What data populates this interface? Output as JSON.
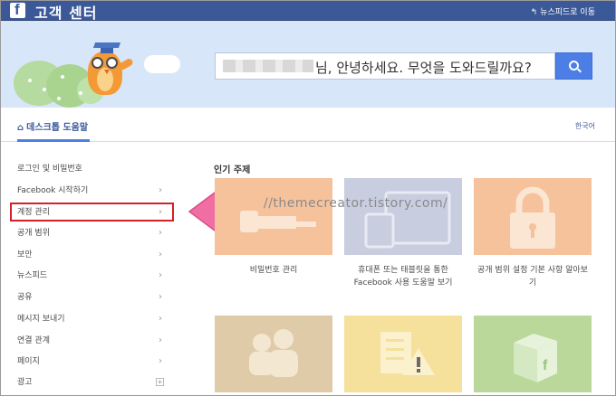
{
  "header": {
    "logo_letter": "f",
    "title": "고객 센터",
    "back_link": "뉴스피드로 이동",
    "back_icon": "back-arrow-icon"
  },
  "search": {
    "text": "님, 안녕하세요. 무엇을 도와드릴까요?"
  },
  "nav": {
    "home_tab": "데스크톱 도움말",
    "language": "한국어"
  },
  "sidebar": {
    "items": [
      {
        "label": "로그인 및 비밀번호"
      },
      {
        "label": "Facebook 시작하기"
      },
      {
        "label": "계정 관리"
      },
      {
        "label": "공개 범위"
      },
      {
        "label": "보안"
      },
      {
        "label": "뉴스피드"
      },
      {
        "label": "공유"
      },
      {
        "label": "메시지 보내기"
      },
      {
        "label": "연결 관계"
      },
      {
        "label": "페이지"
      },
      {
        "label": "광고"
      }
    ]
  },
  "popular": {
    "title": "인기 주제",
    "cards": [
      {
        "label_lines": [
          "비밀번호 관리"
        ],
        "color": "#f5c29c",
        "icon": "key-icon"
      },
      {
        "label_lines": [
          "휴대폰 또는 태블릿을 통한",
          "Facebook 사용 도움말 보기"
        ],
        "color": "#c8cde0",
        "icon": "devices-icon"
      },
      {
        "label_lines": [
          "공개 범위 설정 기본 사항 알아보",
          "기"
        ],
        "color": "#f5c29c",
        "icon": "lock-icon"
      },
      {
        "label_lines": [],
        "color": "#e0cba8",
        "icon": "people-icon"
      },
      {
        "label_lines": [],
        "color": "#f5e09c",
        "icon": "checklist-warning-icon"
      },
      {
        "label_lines": [],
        "color": "#b9d89a",
        "icon": "facebook-box-icon"
      }
    ]
  },
  "watermark": "//themecreator.tistory.com/",
  "colors": {
    "brand": "#3b5998",
    "accent": "#4c7ee6",
    "highlight": "#d42027",
    "arrow": "#f06ea4"
  }
}
